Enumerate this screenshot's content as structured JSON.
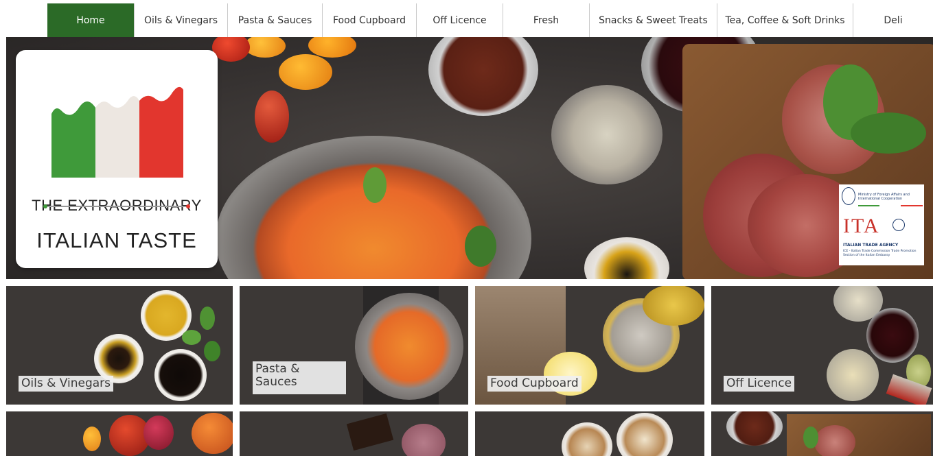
{
  "nav": {
    "items": [
      {
        "label": "Home",
        "active": true
      },
      {
        "label": "Oils & Vinegars"
      },
      {
        "label": "Pasta & Sauces"
      },
      {
        "label": "Food Cupboard"
      },
      {
        "label": "Off Licence"
      },
      {
        "label": "Fresh"
      },
      {
        "label": "Snacks & Sweet Treats"
      },
      {
        "label": "Tea, Coffee & Soft Drinks"
      },
      {
        "label": "Deli"
      }
    ],
    "active_color": "#2b6a27"
  },
  "hero": {
    "logo_line1": "THE EXTRAORDINARY",
    "logo_line2": "ITALIAN TASTE",
    "ita": {
      "ministry_text": "Ministry of Foreign Affairs and International Cooperation",
      "mark": "ITA",
      "agency": "ITALIAN TRADE AGENCY",
      "sub": "ICE - Italian Trade Commission Trade Promotion Section of the Italian Embassy"
    }
  },
  "tiles": [
    {
      "label": "Oils & Vinegars"
    },
    {
      "label_line1": "Pasta &",
      "label_line2": "Sauces"
    },
    {
      "label": "Food Cupboard"
    },
    {
      "label": "Off Licence"
    }
  ],
  "colors": {
    "flag_green": "#3f9a3a",
    "flag_white": "#ede7e1",
    "flag_red": "#e2362e",
    "background_dark": "#3a3633"
  }
}
